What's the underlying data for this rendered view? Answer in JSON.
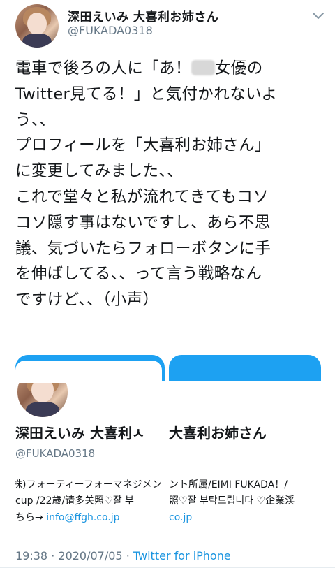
{
  "author": {
    "name": "深田えいみ 大喜利お姉さん",
    "handle": "@FUKADA0318"
  },
  "tweet": {
    "line1a": "電車で後ろの人に「あ！",
    "line1b": "女優の",
    "line2": "Twitter見てる！」と気付かれないよ",
    "line3": "う、、",
    "line4": "プロフィールを「大喜利お姉さん」",
    "line5": "に変更してみました、、",
    "line6": "これで堂々と私が流れてきてもコソ",
    "line7": "コソ隠す事はないですし、あら不思",
    "line8": "議、気づいたらフォローボタンに手",
    "line9": "を伸ばしてる、、って言う戦略なん",
    "line10": "ですけど、、（小声）"
  },
  "profile_card": {
    "name_left": "深田えいみ 大喜利ㅅ",
    "name_right": "大喜利お姉さん",
    "handle": "@FUKADA0318",
    "bio_left_line1": "株)フォーティーフォーマネジメント所属/E",
    "bio_left_line2": "cup /22歳/请多关照♡잘 부",
    "bio_left_line3": "ちら→",
    "bio_left_link": "info@ffgh.co.jp",
    "bio_right_line1": "ント所属/EIMI FUKADA！/",
    "bio_right_line2": "照♡잘 부탁드립니다 ♡企業渓",
    "bio_right_link": "co.jp"
  },
  "meta": {
    "time": "19:38",
    "dot": "·",
    "date": "2020/07/05",
    "source": "Twitter for iPhone"
  },
  "colors": {
    "accent": "#1da1f2",
    "link": "#1b95e0",
    "muted": "#657786"
  },
  "icons": {
    "menu": "chevron-down-icon"
  }
}
